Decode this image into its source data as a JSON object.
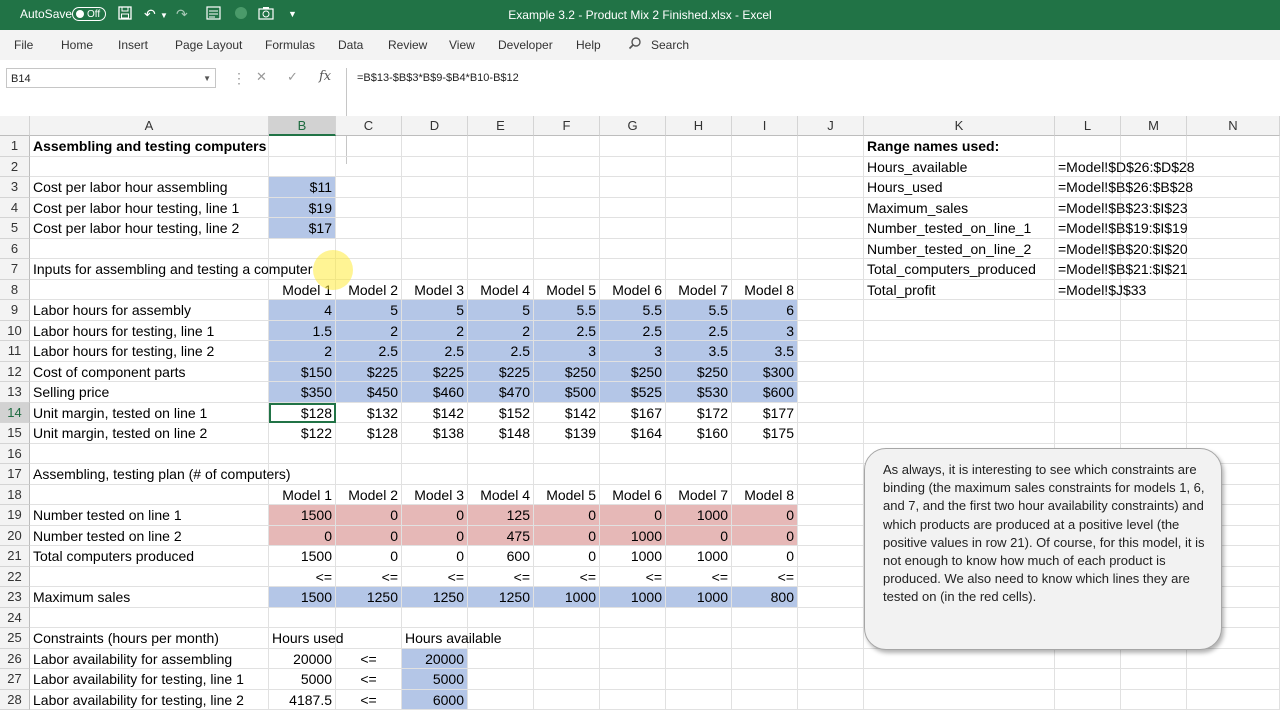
{
  "titlebar": {
    "autosave_label": "AutoSave",
    "autosave_state": "Off",
    "window_title": "Example 3.2 - Product Mix 2 Finished.xlsx  -  Excel",
    "quick_access_icons": [
      "save-icon",
      "undo-icon",
      "redo-icon",
      "form-icon",
      "circle-icon",
      "camera-icon",
      "customize-icon"
    ]
  },
  "ribbon": {
    "tabs": [
      "File",
      "Home",
      "Insert",
      "Page Layout",
      "Formulas",
      "Data",
      "Review",
      "View",
      "Developer",
      "Help"
    ],
    "search_label": "Search"
  },
  "formula_bar": {
    "name_box": "B14",
    "formula": "=B$13-$B$3*B$9-$B4*B10-B$12"
  },
  "columns": [
    "A",
    "B",
    "C",
    "D",
    "E",
    "F",
    "G",
    "H",
    "I",
    "J",
    "K",
    "L",
    "M",
    "N"
  ],
  "selected_column": "B",
  "selected_row": 14,
  "rows": [
    1,
    2,
    3,
    4,
    5,
    6,
    7,
    8,
    9,
    10,
    11,
    12,
    13,
    14,
    15,
    16,
    17,
    18,
    19,
    20,
    21,
    22,
    23,
    24,
    25,
    26,
    27,
    28
  ],
  "sheet": {
    "A1": "Assembling and testing computers",
    "A3": "Cost per labor hour assembling",
    "B3": "$11",
    "A4": "Cost per labor hour testing, line 1",
    "B4": "$19",
    "A5": "Cost per labor hour testing, line 2",
    "B5": "$17",
    "A7": "Inputs for assembling and testing a computer",
    "B8": "Model 1",
    "C8": "Model 2",
    "D8": "Model 3",
    "E8": "Model 4",
    "F8": "Model 5",
    "G8": "Model 6",
    "H8": "Model 7",
    "I8": "Model 8",
    "A9": "Labor hours for assembly",
    "B9": "4",
    "C9": "5",
    "D9": "5",
    "E9": "5",
    "F9": "5.5",
    "G9": "5.5",
    "H9": "5.5",
    "I9": "6",
    "A10": "Labor hours for testing, line 1",
    "B10": "1.5",
    "C10": "2",
    "D10": "2",
    "E10": "2",
    "F10": "2.5",
    "G10": "2.5",
    "H10": "2.5",
    "I10": "3",
    "A11": "Labor hours for testing, line 2",
    "B11": "2",
    "C11": "2.5",
    "D11": "2.5",
    "E11": "2.5",
    "F11": "3",
    "G11": "3",
    "H11": "3.5",
    "I11": "3.5",
    "A12": "Cost of component parts",
    "B12": "$150",
    "C12": "$225",
    "D12": "$225",
    "E12": "$225",
    "F12": "$250",
    "G12": "$250",
    "H12": "$250",
    "I12": "$300",
    "A13": "Selling price",
    "B13": "$350",
    "C13": "$450",
    "D13": "$460",
    "E13": "$470",
    "F13": "$500",
    "G13": "$525",
    "H13": "$530",
    "I13": "$600",
    "A14": "Unit margin, tested on line 1",
    "B14": "$128",
    "C14": "$132",
    "D14": "$142",
    "E14": "$152",
    "F14": "$142",
    "G14": "$167",
    "H14": "$172",
    "I14": "$177",
    "A15": "Unit margin, tested on line 2",
    "B15": "$122",
    "C15": "$128",
    "D15": "$138",
    "E15": "$148",
    "F15": "$139",
    "G15": "$164",
    "H15": "$160",
    "I15": "$175",
    "A17": "Assembling, testing plan (# of computers)",
    "B18": "Model 1",
    "C18": "Model 2",
    "D18": "Model 3",
    "E18": "Model 4",
    "F18": "Model 5",
    "G18": "Model 6",
    "H18": "Model 7",
    "I18": "Model 8",
    "A19": "Number tested on line 1",
    "B19": "1500",
    "C19": "0",
    "D19": "0",
    "E19": "125",
    "F19": "0",
    "G19": "0",
    "H19": "1000",
    "I19": "0",
    "A20": "Number tested on line 2",
    "B20": "0",
    "C20": "0",
    "D20": "0",
    "E20": "475",
    "F20": "0",
    "G20": "1000",
    "H20": "0",
    "I20": "0",
    "A21": "Total computers produced",
    "B21": "1500",
    "C21": "0",
    "D21": "0",
    "E21": "600",
    "F21": "0",
    "G21": "1000",
    "H21": "1000",
    "I21": "0",
    "B22": "<=",
    "C22": "<=",
    "D22": "<=",
    "E22": "<=",
    "F22": "<=",
    "G22": "<=",
    "H22": "<=",
    "I22": "<=",
    "A23": "Maximum sales",
    "B23": "1500",
    "C23": "1250",
    "D23": "1250",
    "E23": "1250",
    "F23": "1000",
    "G23": "1000",
    "H23": "1000",
    "I23": "800",
    "A25": "Constraints (hours per month)",
    "B25": "Hours used",
    "D25": "Hours available",
    "A26": "Labor availability for assembling",
    "B26": "20000",
    "C26": "<=",
    "D26": "20000",
    "A27": "Labor availability for testing, line 1",
    "B27": "5000",
    "C27": "<=",
    "D27": "5000",
    "A28": "Labor availability for testing, line 2",
    "B28": "4187.5",
    "C28": "<=",
    "D28": "6000",
    "K1": "Range names used:",
    "K2": "Hours_available",
    "L2": "=Model!$D$26:$D$28",
    "K3": "Hours_used",
    "L3": "=Model!$B$26:$B$28",
    "K4": "Maximum_sales",
    "L4": "=Model!$B$23:$I$23",
    "K5": "Number_tested_on_line_1",
    "L5": "=Model!$B$19:$I$19",
    "K6": "Number_tested_on_line_2",
    "L6": "=Model!$B$20:$I$20",
    "K7": "Total_computers_produced",
    "L7": "=Model!$B$21:$I$21",
    "K8": "Total_profit",
    "L8": "=Model!$J$33"
  },
  "note_text": "As always, it is interesting to see which constraints are binding (the maximum sales constraints for models 1, 6, and 7, and the first two hour availability constraints) and which products are produced at a positive level (the positive values in row 21). Of course, for this model, it is not enough to know how much of each product is produced. We also need to know which lines they are tested on (in the red cells).",
  "colors": {
    "excel_green": "#217346",
    "input_blue": "#b4c6e7",
    "decision_red": "#e6b8b7",
    "cursor_highlight": "#ffeb3c"
  }
}
